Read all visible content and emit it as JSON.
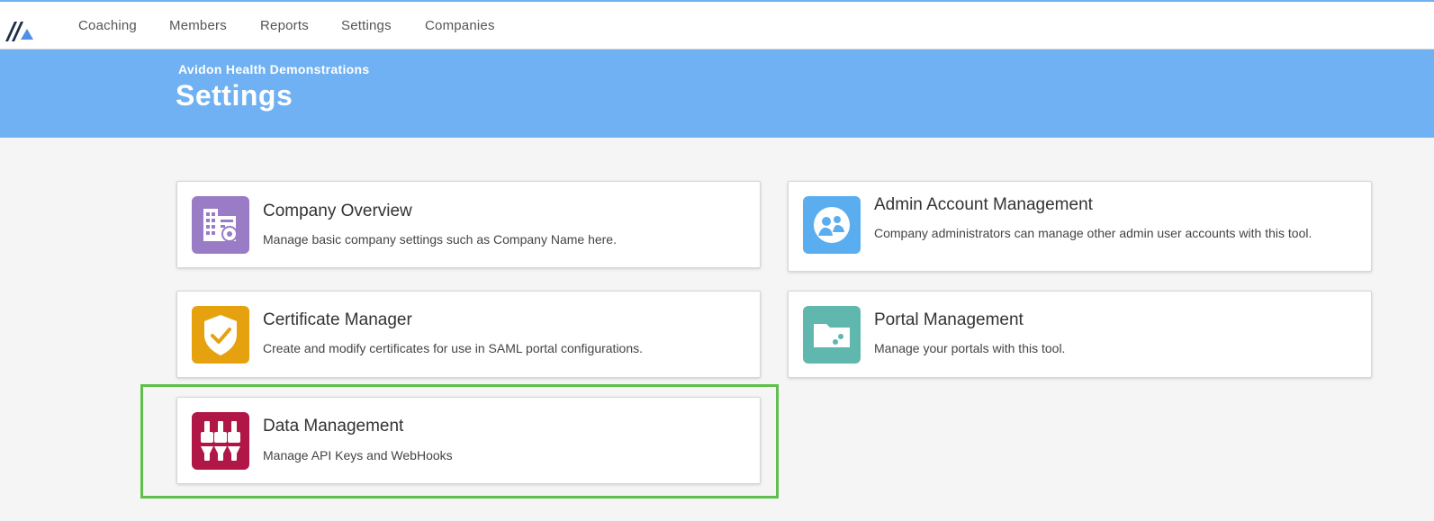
{
  "nav": {
    "items": [
      {
        "label": "Coaching"
      },
      {
        "label": "Members"
      },
      {
        "label": "Reports"
      },
      {
        "label": "Settings"
      },
      {
        "label": "Companies"
      }
    ]
  },
  "header": {
    "organization": "Avidon Health Demonstrations",
    "title": "Settings"
  },
  "cards": [
    {
      "title": "Company Overview",
      "description": "Manage basic company settings such as Company Name here.",
      "icon": "building-gear-icon",
      "color": "#9a7cc6"
    },
    {
      "title": "Admin Account Management",
      "description": "Company administrators can manage other admin user accounts with this tool.",
      "icon": "users-circle-icon",
      "color": "#5aaef0"
    },
    {
      "title": "Certificate Manager",
      "description": "Create and modify certificates for use in SAML portal configurations.",
      "icon": "shield-check-icon",
      "color": "#e6a10f"
    },
    {
      "title": "Portal Management",
      "description": "Manage your portals with this tool.",
      "icon": "folder-icon",
      "color": "#5fb7ae"
    },
    {
      "title": "Data Management",
      "description": "Manage API Keys and WebHooks",
      "icon": "plug-connectors-icon",
      "color": "#b01747"
    }
  ],
  "colors": {
    "accent": "#6fb1f2",
    "highlight": "#5fbf4a"
  }
}
